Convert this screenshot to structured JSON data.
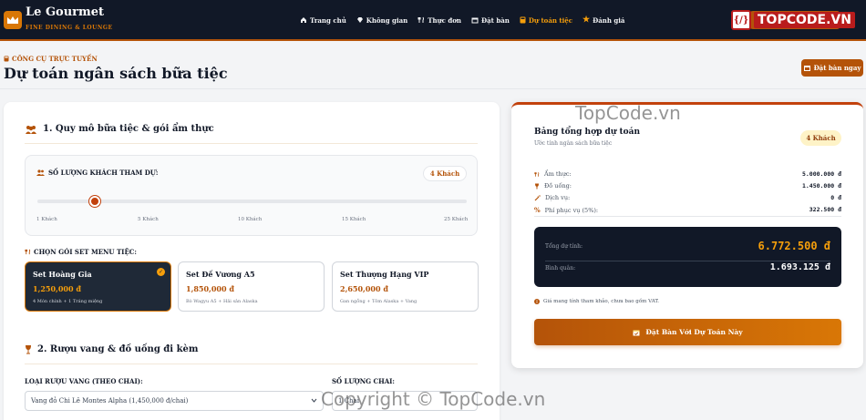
{
  "brand": {
    "name": "Le Gourmet",
    "tagline": "FINE DINING & LOUNGE"
  },
  "nav": {
    "items": [
      {
        "label": "Trang chủ",
        "icon": "home-icon",
        "active": false
      },
      {
        "label": "Không gian",
        "icon": "gem-icon",
        "active": false
      },
      {
        "label": "Thực đơn",
        "icon": "utensils-icon",
        "active": false
      },
      {
        "label": "Đặt bàn",
        "icon": "calendar-icon",
        "active": false
      },
      {
        "label": "Dự toán tiệc",
        "icon": "calculator-icon",
        "active": true
      },
      {
        "label": "Đánh giá",
        "icon": "star-icon",
        "active": false
      }
    ]
  },
  "watermark": {
    "logo_text": "TOPCODE.VN",
    "site": "TopCode.vn",
    "copyright": "Copyright © TopCode.vn"
  },
  "header": {
    "kicker": "CÔNG CỤ TRỰC TUYẾN",
    "title": "Dự toán ngân sách bữa tiệc",
    "book_button": "Đặt bàn ngay"
  },
  "section1": {
    "title": "1. Quy mô bữa tiệc & gói ẩm thực",
    "guest_label": "SỐ LƯỢNG KHÁCH THAM DỰ:",
    "guest_value": "4 Khách",
    "slider": {
      "value": 4,
      "min": 1,
      "max": 25
    },
    "ticks": [
      "1 Khách",
      "5 Khách",
      "10 Khách",
      "15 Khách",
      "25 Khách"
    ],
    "menu_label": "CHỌN GÓI SET MENU TIỆC:",
    "packages": [
      {
        "name": "Set Hoàng Gia",
        "price": "1,250,000 đ",
        "desc": "4 Món chính + 1 Tráng miệng",
        "selected": true
      },
      {
        "name": "Set Đế Vương A5",
        "price": "1,850,000 đ",
        "desc": "Bò Wagyu A5 + Hải sản Alaska",
        "selected": false
      },
      {
        "name": "Set Thượng Hạng VIP",
        "price": "2,650,000 đ",
        "desc": "Gan ngỗng + Tôm Alaska + Vang",
        "selected": false
      }
    ]
  },
  "section2": {
    "title": "2. Rượu vang & đồ uống đi kèm",
    "wine_label": "LOẠI RƯỢU VANG (THEO CHAI):",
    "wine_value": "Vang đỏ Chi Lê Montes Alpha (1,450,000 đ/chai)",
    "qty_label": "SỐ LƯỢNG CHAI:",
    "qty_value": "1 Chai"
  },
  "summary": {
    "title": "Bảng tổng hợp dự toán",
    "subtitle": "Ước tính ngân sách bữa tiệc",
    "guests": "4 Khách",
    "lines": [
      {
        "label": "Ẩm thực:",
        "value": "5.000.000 đ",
        "icon": "utensils-icon"
      },
      {
        "label": "Đồ uống:",
        "value": "1.450.000 đ",
        "icon": "wine-icon"
      },
      {
        "label": "Dịch vụ:",
        "value": "0 đ",
        "icon": "magic-icon"
      },
      {
        "label": "Phí phục vụ (5%):",
        "value": "322.500 đ",
        "icon": "percent-icon"
      }
    ],
    "total_label": "Tổng dự tính:",
    "total_value": "6.772.500 đ",
    "avg_label": "Bình quân:",
    "avg_value": "1.693.125 đ",
    "note": "Giá mang tính tham khảo, chưa bao gồm VAT.",
    "cta": "Đặt Bàn Với Dự Toán Này"
  },
  "colors": {
    "accent": "#b45309",
    "dark": "#111827",
    "gold": "#f59e0b"
  }
}
